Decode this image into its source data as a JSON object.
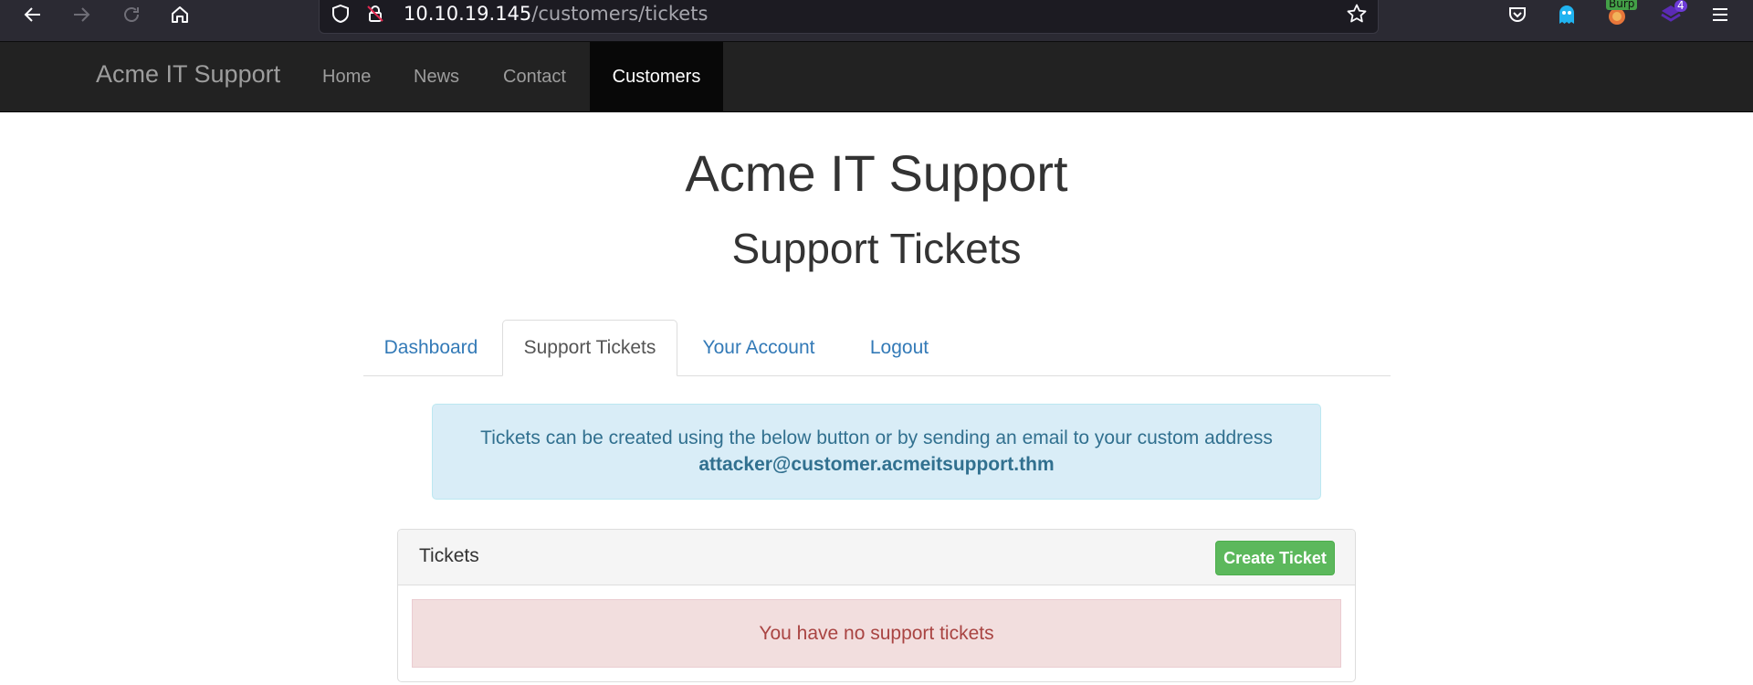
{
  "browser": {
    "url_host": "10.10.19.145",
    "url_path": "/customers/tickets",
    "extensions": {
      "burp_label": "Burp",
      "badge_count": "4"
    }
  },
  "navbar": {
    "brand": "Acme IT Support",
    "items": [
      {
        "label": "Home"
      },
      {
        "label": "News"
      },
      {
        "label": "Contact"
      },
      {
        "label": "Customers"
      }
    ]
  },
  "page": {
    "title": "Acme IT Support",
    "subtitle": "Support Tickets"
  },
  "tabs": [
    {
      "label": "Dashboard"
    },
    {
      "label": "Support Tickets"
    },
    {
      "label": "Your Account"
    },
    {
      "label": "Logout"
    }
  ],
  "info_alert": {
    "text": "Tickets can be created using the below button or by sending an email to your custom address",
    "email": "attacker@customer.acmeitsupport.thm"
  },
  "tickets_panel": {
    "title": "Tickets",
    "create_button": "Create Ticket",
    "empty_message": "You have no support tickets"
  },
  "colors": {
    "navbar_bg": "#222222",
    "link": "#337ab7",
    "success": "#5cb85c",
    "info_bg": "#d9edf7",
    "danger_bg": "#f2dede"
  }
}
